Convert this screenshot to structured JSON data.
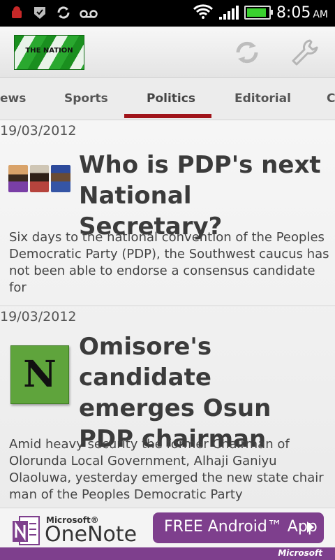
{
  "status_bar": {
    "time": "8:05",
    "ampm": "AM",
    "icons": [
      "android-debug-icon",
      "check-shield-icon",
      "sync-icon",
      "voicemail-icon",
      "wifi-icon",
      "signal-icon",
      "battery-icon"
    ],
    "battery_level": 0.9
  },
  "header": {
    "logo_text": "THE NATION",
    "refresh_icon": "refresh-icon",
    "settings_icon": "wrench-icon"
  },
  "tabs": [
    {
      "label": "ews"
    },
    {
      "label": "Sports"
    },
    {
      "label": "Politics"
    },
    {
      "label": "Editorial"
    },
    {
      "label": "C"
    }
  ],
  "active_tab": "Politics",
  "articles": [
    {
      "date": "19/03/2012",
      "title": "Who is PDP's next National Secretary?",
      "body": "Six days to the national convention of the Peoples Democratic Party (PDP), the Southwest caucus has not been able to endorse a consensus candidate for"
    },
    {
      "date": "19/03/2012",
      "thumb_letter": "N",
      "title": "Omisore's candidate emerges Osun PDP chairman",
      "body": "Amid heavy security the former Chairman of Olorunda Local Government, Alhaji Ganiyu Olaoluwa, yesterday emerged the new state chair man of the Peoples Democratic Party"
    }
  ],
  "ad": {
    "brand": "Microsoft®",
    "product": "OneNote",
    "cta": "FREE Android™ App",
    "footer": "Microsoft",
    "colors": {
      "accent": "#7e3f8d"
    }
  },
  "colors": {
    "tab_underline": "#a0141a"
  }
}
